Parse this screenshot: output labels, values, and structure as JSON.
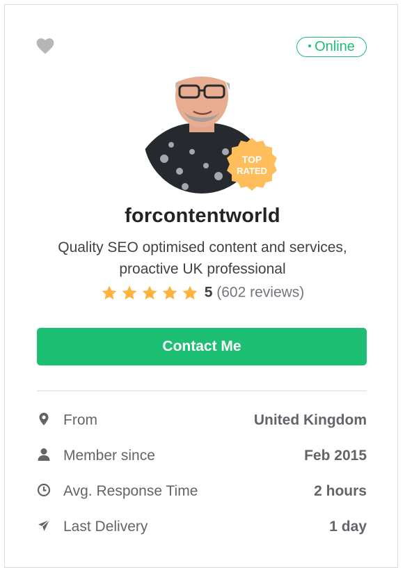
{
  "profile": {
    "status": "Online",
    "username": "forcontentworld",
    "tagline_line1": "Quality SEO optimised content and services,",
    "tagline_line2": "proactive UK professional",
    "badge_line1": "TOP",
    "badge_line2": "RATED",
    "rating": {
      "stars": 5,
      "score": "5",
      "reviews": "(602 reviews)"
    },
    "contact_label": "Contact Me"
  },
  "stats": [
    {
      "icon": "location-pin-icon",
      "label": "From",
      "value": "United Kingdom"
    },
    {
      "icon": "user-icon",
      "label": "Member since",
      "value": "Feb 2015"
    },
    {
      "icon": "clock-icon",
      "label": "Avg. Response Time",
      "value": "2 hours"
    },
    {
      "icon": "paper-plane-icon",
      "label": "Last Delivery",
      "value": "1 day"
    }
  ],
  "colors": {
    "accent": "#1dbf73",
    "star": "#ffb33e",
    "badge": "#ffbe5b",
    "text_dark": "#222325",
    "text_muted": "#62646a"
  }
}
